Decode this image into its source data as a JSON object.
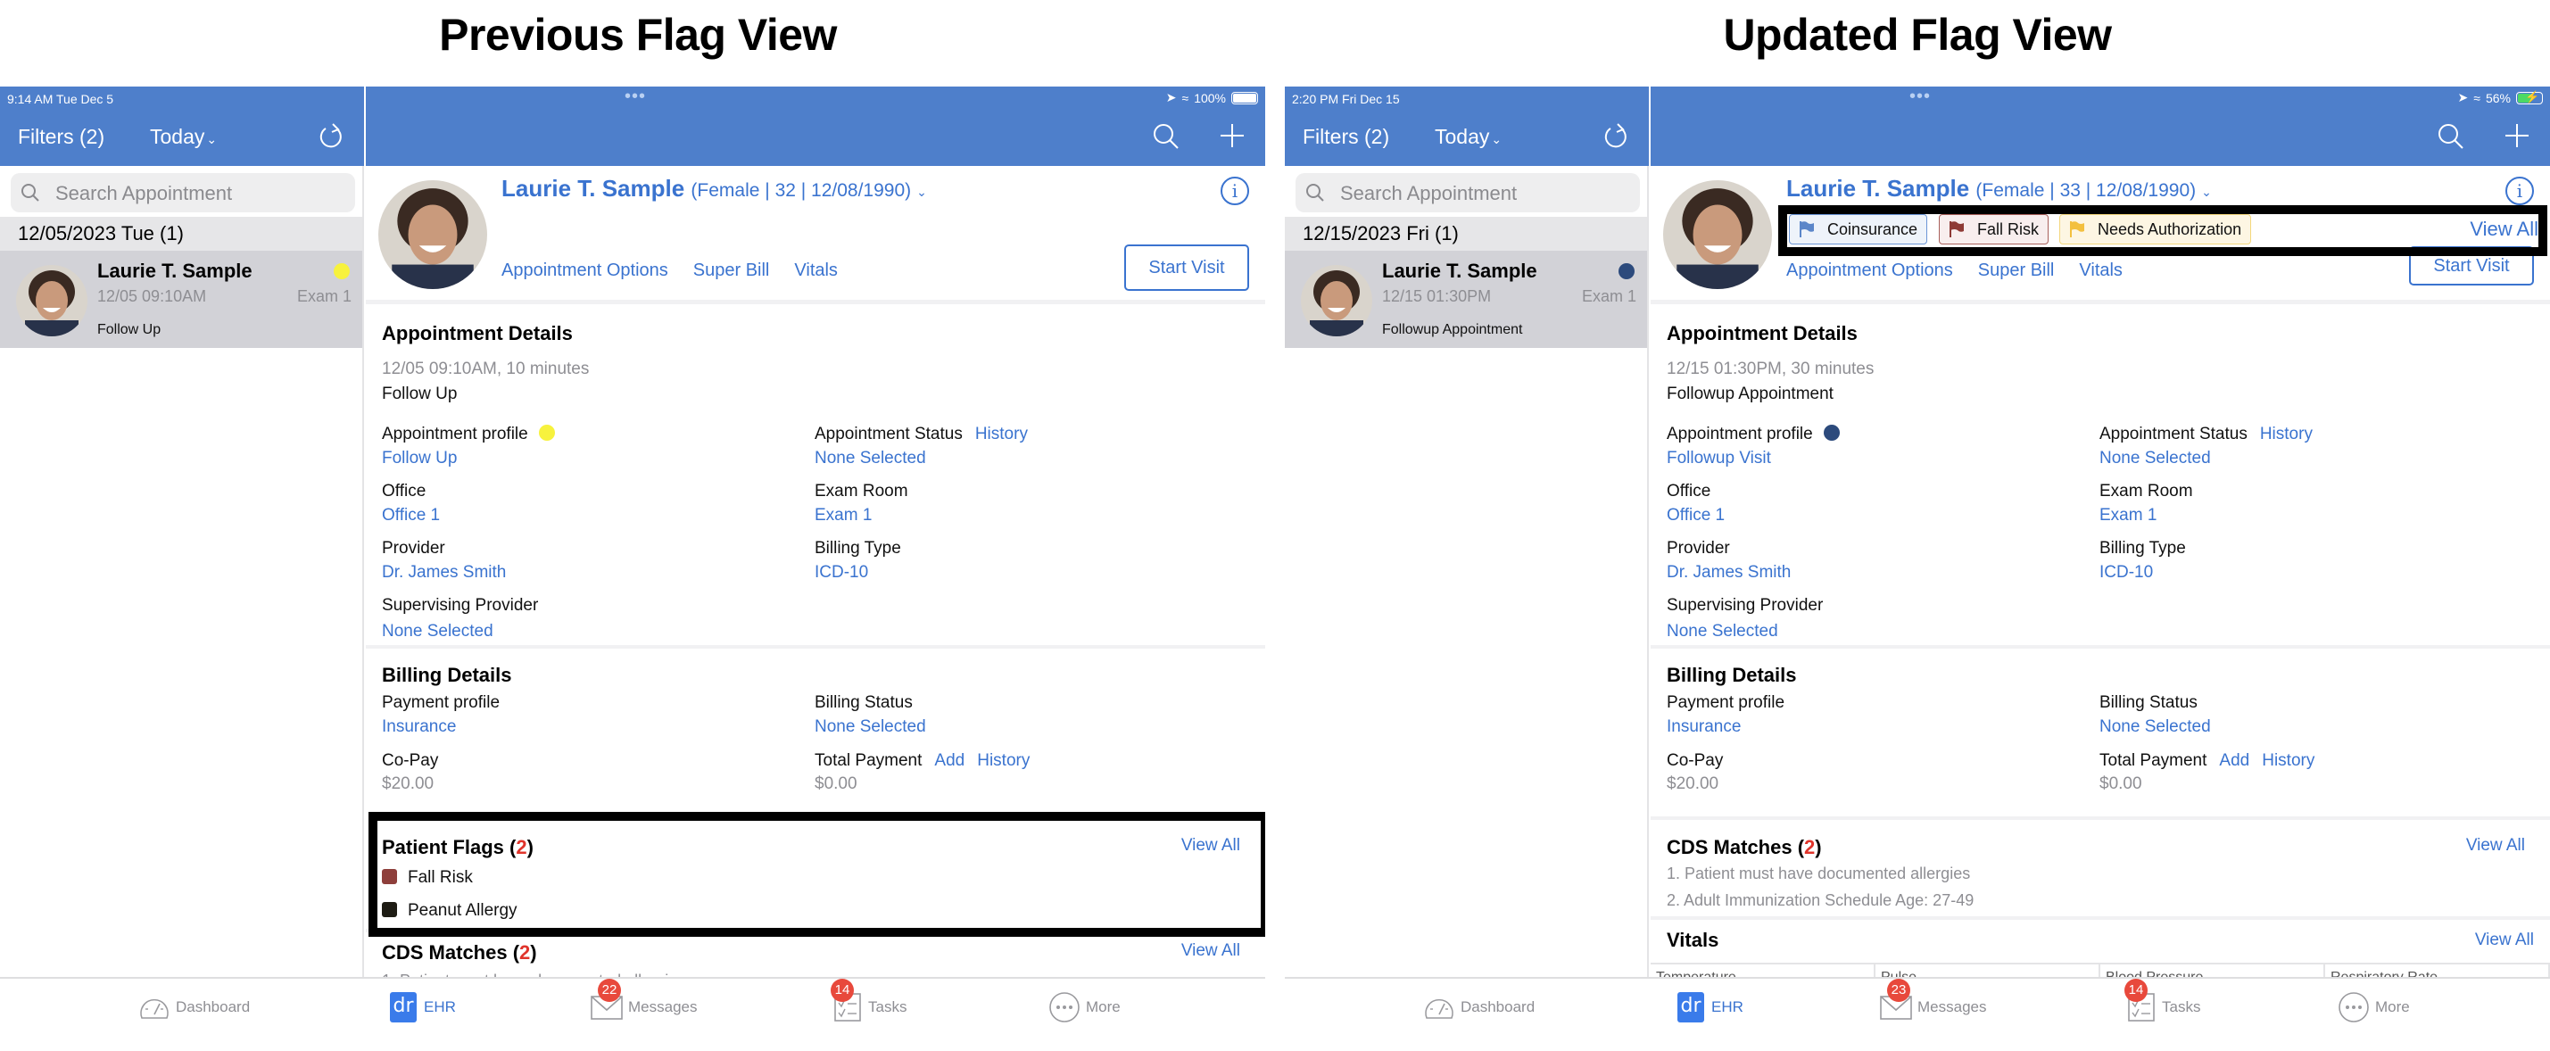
{
  "titles": {
    "left": "Previous Flag View",
    "right": "Updated Flag View"
  },
  "common": {
    "filters_label": "Filters (2)",
    "today_label": "Today",
    "search_placeholder": "Search Appointment",
    "patient_name": "Laurie T. Sample",
    "patient_links": [
      "Appointment Options",
      "Super Bill",
      "Vitals"
    ],
    "start_visit": "Start Visit",
    "appointment_details_title": "Appointment Details",
    "appointment_profile_label": "Appointment profile",
    "appointment_status_label": "Appointment Status",
    "history_link": "History",
    "none_selected": "None Selected",
    "office_label": "Office",
    "office_value": "Office 1",
    "exam_room_label": "Exam Room",
    "exam_room_value": "Exam 1",
    "provider_label": "Provider",
    "provider_value": "Dr. James Smith",
    "billing_type_label": "Billing Type",
    "billing_type_value": "ICD-10",
    "supervising_label": "Supervising Provider",
    "billing_details_title": "Billing Details",
    "payment_profile_label": "Payment profile",
    "payment_profile_value": "Insurance",
    "billing_status_label": "Billing Status",
    "copay_label": "Co-Pay",
    "copay_value": "$20.00",
    "total_payment_label": "Total Payment",
    "add_link": "Add",
    "total_payment_value": "$0.00",
    "cds_title": "CDS Matches",
    "cds_count": "2",
    "cds_items": [
      "1. Patient must have documented allergies",
      "2. Adult Immunization Schedule Age: 27-49"
    ],
    "view_all": "View All",
    "vitals_title": "Vitals",
    "vitals_columns": [
      "Temperature",
      "Pulse",
      "Blood Pressure",
      "Respiratory Rate"
    ],
    "tabs": [
      {
        "label": "Dashboard",
        "icon": "dashboard-gauge-icon"
      },
      {
        "label": "EHR",
        "icon": "dr-logo-icon",
        "logo_text": "dr"
      },
      {
        "label": "Messages",
        "icon": "envelope-icon"
      },
      {
        "label": "Tasks",
        "icon": "checklist-icon"
      },
      {
        "label": "More",
        "icon": "more-dots-icon"
      }
    ],
    "brand_blue": "#4e7fcb",
    "link_blue": "#3a73cf"
  },
  "left": {
    "status_time": "9:14 AM   Tue Dec 5",
    "battery": "100%",
    "date_header": "12/05/2023 Tue (1)",
    "appt_time": "12/05 09:10AM",
    "appt_room": "Exam 1",
    "appt_visit_type": "Follow Up",
    "appt_dot_color": "#f7f23d",
    "patient_meta": "(Female | 32 | 12/08/1990)",
    "details_datetime": "12/05 09:10AM, 10 minutes",
    "details_visit_type": "Follow Up",
    "appointment_profile_value": "Follow  Up",
    "patient_flags_title": "Patient Flags",
    "patient_flags_count": "2",
    "patient_flags": [
      {
        "label": "Fall Risk",
        "color": "#8e3f3b"
      },
      {
        "label": "Peanut Allergy",
        "color": "#1e1c14"
      }
    ],
    "messages_badge": "22",
    "tasks_badge": "14"
  },
  "right": {
    "status_time": "2:20 PM   Fri Dec 15",
    "battery": "56%",
    "date_header": "12/15/2023 Fri (1)",
    "appt_time": "12/15 01:30PM",
    "appt_room": "Exam 1",
    "appt_visit_type": "Followup Appointment",
    "appt_dot_color": "#2c4a7c",
    "patient_meta": "(Female | 33 | 12/08/1990)",
    "flag_chips": [
      {
        "label": "Coinsurance",
        "flag_color": "#5b86c9",
        "bg": "#eef3fa",
        "border": "#6b95d6"
      },
      {
        "label": "Fall Risk",
        "flag_color": "#8e3a35",
        "bg": "#f8eeee",
        "border": "#a8605b"
      },
      {
        "label": "Needs Authorization",
        "flag_color": "#f3c03f",
        "bg": "#fdf6e3",
        "border": "#f3d77c"
      }
    ],
    "details_datetime": "12/15 01:30PM, 30 minutes",
    "details_visit_type": "Followup Appointment",
    "appointment_profile_value": "Followup Visit",
    "messages_badge": "23",
    "tasks_badge": "14"
  }
}
